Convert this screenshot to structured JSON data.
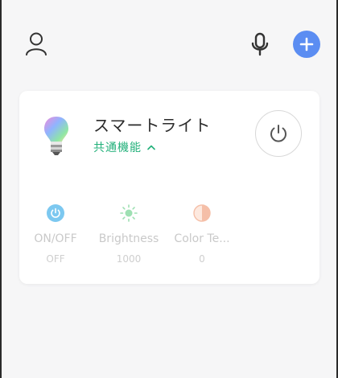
{
  "device": {
    "name": "スマートライト",
    "common_functions_label": "共通機能"
  },
  "controls": [
    {
      "label": "ON/OFF",
      "value": "OFF",
      "icon": "power-icon"
    },
    {
      "label": "Brightness",
      "value": "1000",
      "icon": "sun-icon"
    },
    {
      "label": "Color Te...",
      "value": "0",
      "icon": "half-circle-icon"
    }
  ],
  "icons": {
    "user": "user-icon",
    "mic": "mic-icon",
    "add": "plus-icon",
    "bulb": "bulb-icon",
    "power": "power-icon",
    "chevron": "chevron-up-icon"
  },
  "colors": {
    "accent_blue": "#5b8df2",
    "accent_green": "#22b07a",
    "power_icon_blue": "#7cc8f0",
    "brightness_green": "#9ee0b3",
    "color_temp_orange": "#f5bfa8"
  }
}
